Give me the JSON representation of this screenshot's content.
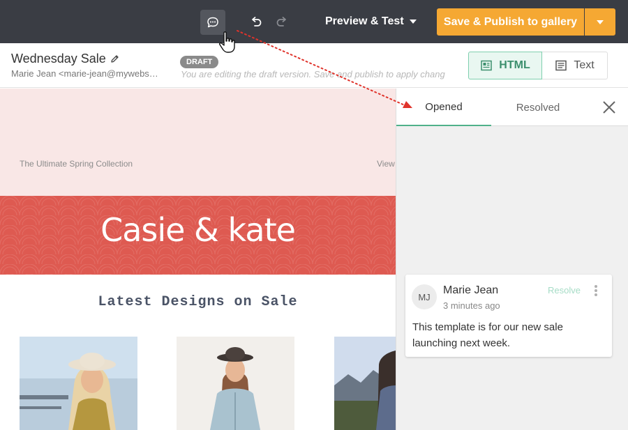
{
  "toolbar": {
    "preview_label": "Preview & Test",
    "publish_label": "Save & Publish to gallery"
  },
  "document": {
    "title": "Wednesday Sale",
    "sender": "Marie Jean <marie-jean@mywebs…",
    "status_badge": "DRAFT",
    "draft_note": "You are editing the draft version. Save and publish to apply chang"
  },
  "view_toggle": {
    "html_label": "HTML",
    "text_label": "Text",
    "active": "HTML"
  },
  "email": {
    "preheader": "The Ultimate Spring Collection",
    "view_link": "View",
    "brand": "Casie & kate",
    "section_title": "Latest Designs on Sale"
  },
  "comments": {
    "tabs": [
      {
        "label": "Opened",
        "active": true
      },
      {
        "label": "Resolved",
        "active": false
      }
    ],
    "items": [
      {
        "initials": "MJ",
        "author": "Marie Jean",
        "time": "3 minutes ago",
        "action": "Resolve",
        "body": "This template is for our new sale launching next week."
      }
    ]
  },
  "colors": {
    "toolbar_bg": "#3a3d44",
    "publish_accent": "#f5a833",
    "active_green": "#4fb08a",
    "brand_red": "#de5a51",
    "pink_band": "#f9e7e6",
    "annotation_red": "#e0332b"
  },
  "icons": {
    "comment": "comment-bubble-icon",
    "undo": "undo-icon",
    "redo": "redo-icon",
    "edit": "pencil-icon",
    "html": "code-document-icon",
    "text": "text-lines-icon",
    "close": "close-icon",
    "more": "more-vertical-icon",
    "cursor": "hand-pointer-icon"
  }
}
